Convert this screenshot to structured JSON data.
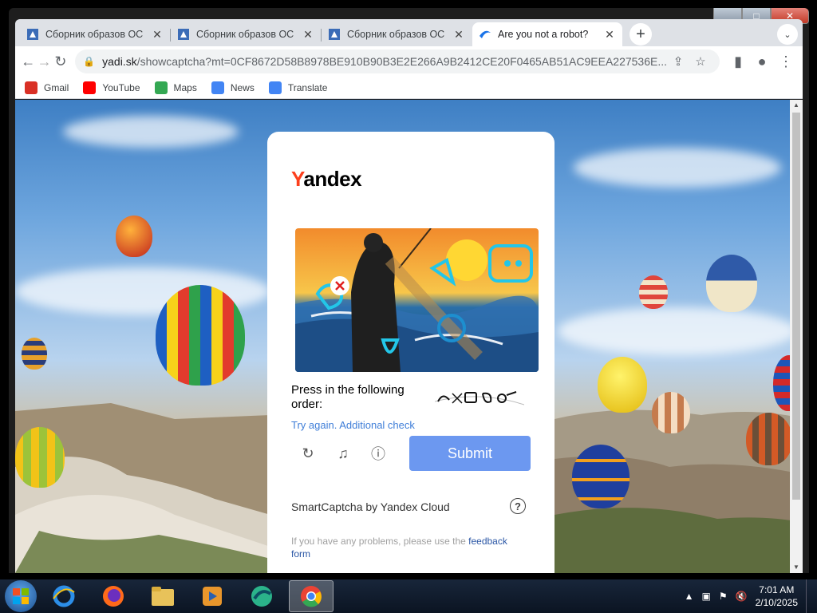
{
  "window": {
    "minimize": "▁",
    "maximize": "□",
    "close": "✕"
  },
  "tabs": [
    {
      "title": "Сборник образов ОС",
      "icon": "doc-icon",
      "close": "✕"
    },
    {
      "title": "Сборник образов ОС",
      "icon": "doc-icon",
      "close": "✕"
    },
    {
      "title": "Сборник образов ОС",
      "icon": "doc-icon",
      "close": "✕"
    },
    {
      "title": "Are you not a robot?",
      "icon": "yandex-captcha-icon",
      "close": "✕"
    }
  ],
  "new_tab": "+",
  "tab_search": "⌄",
  "nav": {
    "back": "←",
    "forward": "→",
    "reload": "↻"
  },
  "omnibox": {
    "host": "yadi.sk",
    "path": "/showcaptcha?mt=0CF8672D58B8978BE910B90B3E2E266A9B2412CE20F0465AB51AC9EEA227536E..."
  },
  "bookmarks": [
    {
      "label": "Gmail",
      "color": "#d93025"
    },
    {
      "label": "YouTube",
      "color": "#ff0000"
    },
    {
      "label": "Maps",
      "color": "#34a853"
    },
    {
      "label": "News",
      "color": "#4285f4"
    },
    {
      "label": "Translate",
      "color": "#4285f4"
    }
  ],
  "captcha": {
    "logo_first": "Y",
    "logo_rest": "andex",
    "instruction": "Press in the following order:",
    "retry_text": "Try again. Additional check",
    "submit": "Submit",
    "footer": "SmartCaptcha by Yandex Cloud",
    "help": "?",
    "problems_text": "If you have any problems, please use the ",
    "problems_link": "feedback form"
  },
  "taskbar": {
    "apps": [
      "internet-explorer",
      "firefox",
      "file-explorer",
      "media-player",
      "browser-globe",
      "chrome"
    ],
    "time": "7:01 AM",
    "date": "2/10/2025"
  }
}
